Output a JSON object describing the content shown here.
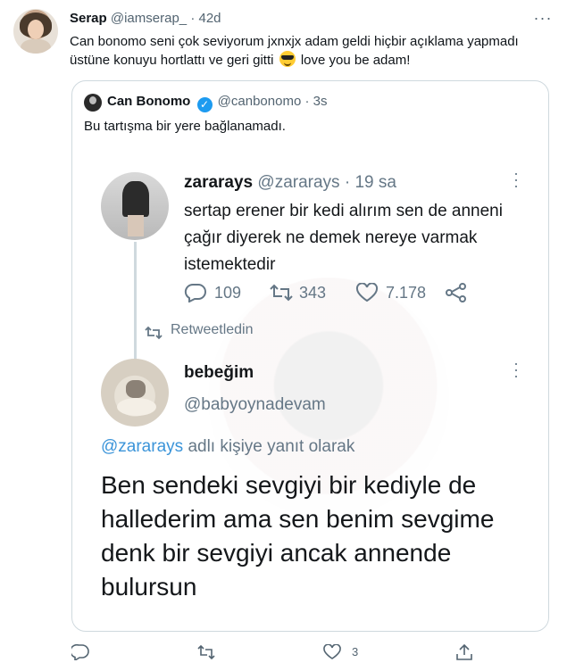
{
  "tweet": {
    "display_name": "Serap",
    "handle": "@iamserap_",
    "separator": "·",
    "time": "42d",
    "text_before_emoji": "Can bonomo seni çok seviyorum jxnxjx adam geldi hiçbir açıklama yapmadı üstüne konuyu hortlattı ve geri gitti",
    "text_after_emoji": "love you be adam!",
    "emoji": "smiling-face-with-sunglasses",
    "like_count": "3"
  },
  "quoted": {
    "display_name": "Can Bonomo",
    "handle": "@canbonomo",
    "separator": "·",
    "time": "3s",
    "text": "Bu tartışma bir yere bağlanamadı."
  },
  "screenshot": {
    "first": {
      "display_name": "zararays",
      "handle": "@zararays",
      "separator": "·",
      "time": "19 sa",
      "text": "sertap erener bir kedi alırım sen de anneni çağır diyerek ne demek nereye varmak istemektedir",
      "replies": "109",
      "retweets": "343",
      "likes": "7.178"
    },
    "retweet_label": "Retweetledin",
    "second": {
      "display_name": "bebeğim",
      "handle": "@babyoynadevam",
      "reply_mention": "@zararays",
      "reply_suffix": "adlı kişiye yanıt olarak",
      "text": "Ben sendeki sevgiyi bir kediyle de hallederim ama sen benim sevgime denk bir sevgiyi ancak annende bulursun"
    }
  },
  "colors": {
    "text": "#0f1419",
    "secondary": "#536471",
    "link": "#3b94d9",
    "verified": "#1d9bf0",
    "border": "#cfd9de"
  }
}
